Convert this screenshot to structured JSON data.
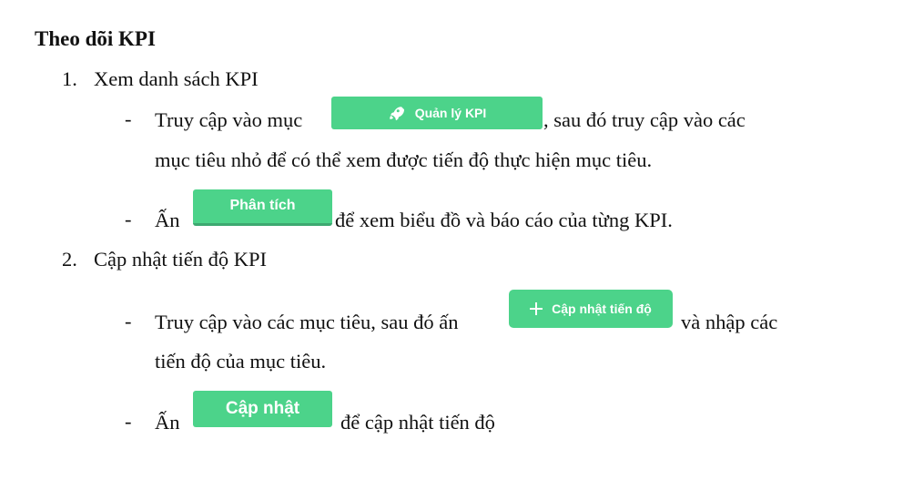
{
  "heading": "Theo dõi KPI",
  "section1": {
    "number": "1.",
    "title": "Xem danh sách KPI",
    "bullet1": {
      "dash": "-",
      "before": "Truy cập vào mục",
      "after": ", sau đó truy cập vào các",
      "line2": "mục tiêu nhỏ để có thể xem được tiến độ thực hiện mục tiêu.",
      "button_label": "Quản lý KPI",
      "button_icon": "rocket-icon"
    },
    "bullet2": {
      "dash": "-",
      "before": "Ấn",
      "after": "để xem biểu đồ và báo cáo của từng KPI.",
      "button_label": "Phân tích"
    }
  },
  "section2": {
    "number": "2.",
    "title": "Cập nhật tiến độ KPI",
    "bullet1": {
      "dash": "-",
      "before": "Truy cập vào các mục tiêu, sau đó ấn",
      "after": "và nhập các",
      "line2": "tiến độ của mục tiêu.",
      "button_label": "Cập nhật tiến độ",
      "button_icon": "plus-icon"
    },
    "bullet2": {
      "dash": "-",
      "before": "Ấn",
      "after": "để cập nhật tiến độ",
      "button_label": "Cập nhật"
    }
  },
  "colors": {
    "button_green": "#4cd38a",
    "button_text": "#ffffff"
  }
}
